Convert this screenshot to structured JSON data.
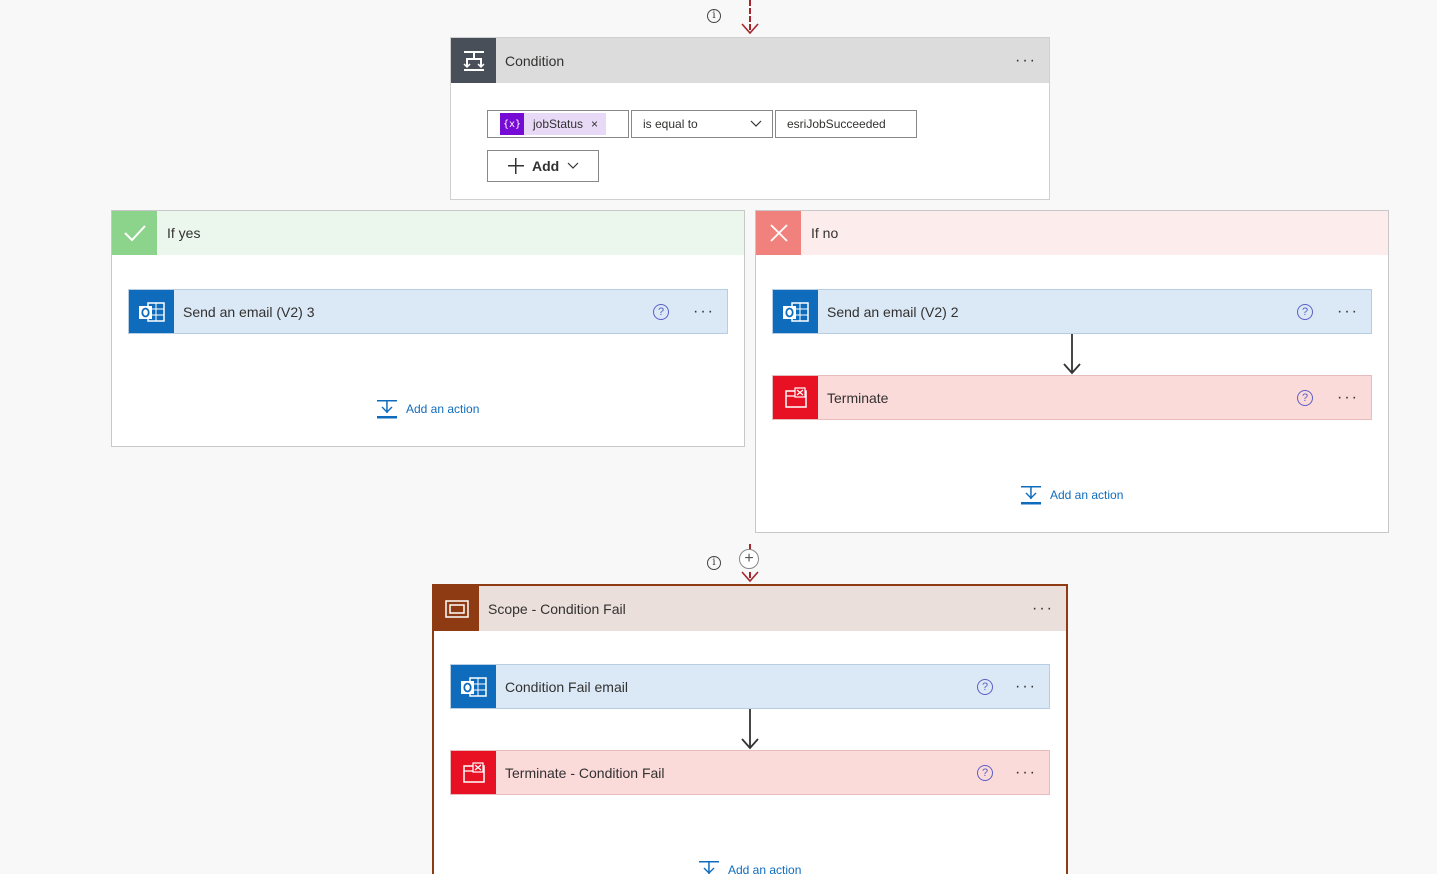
{
  "condition": {
    "title": "Condition",
    "token_label": "jobStatus",
    "token_icon_text": "{x}",
    "token_remove": "×",
    "operator": "is equal to",
    "value": "esriJobSucceeded",
    "add_label": "Add"
  },
  "if_yes": {
    "title": "If yes",
    "actions": [
      {
        "title": "Send an email (V2) 3"
      }
    ],
    "add_action_label": "Add an action"
  },
  "if_no": {
    "title": "If no",
    "actions": [
      {
        "title": "Send an email (V2) 2"
      },
      {
        "title": "Terminate"
      }
    ],
    "add_action_label": "Add an action"
  },
  "scope": {
    "title": "Scope - Condition Fail",
    "actions": [
      {
        "title": "Condition Fail email"
      },
      {
        "title": "Terminate - Condition Fail"
      }
    ],
    "add_action_label": "Add an action"
  },
  "colors": {
    "condition_header": "#dcdcdc",
    "condition_icon": "#484f58",
    "yes_header": "#ebf6ec",
    "yes_icon": "#8cd38c",
    "no_header": "#fdecec",
    "no_icon": "#f1817c",
    "email_icon": "#0f6cbd",
    "terminate_icon": "#e81123",
    "scope_border": "#8e3a13",
    "dashed_connector": "#a4262c"
  },
  "icons": {
    "info": "i",
    "help": "?",
    "more": "···",
    "plus": "+"
  }
}
